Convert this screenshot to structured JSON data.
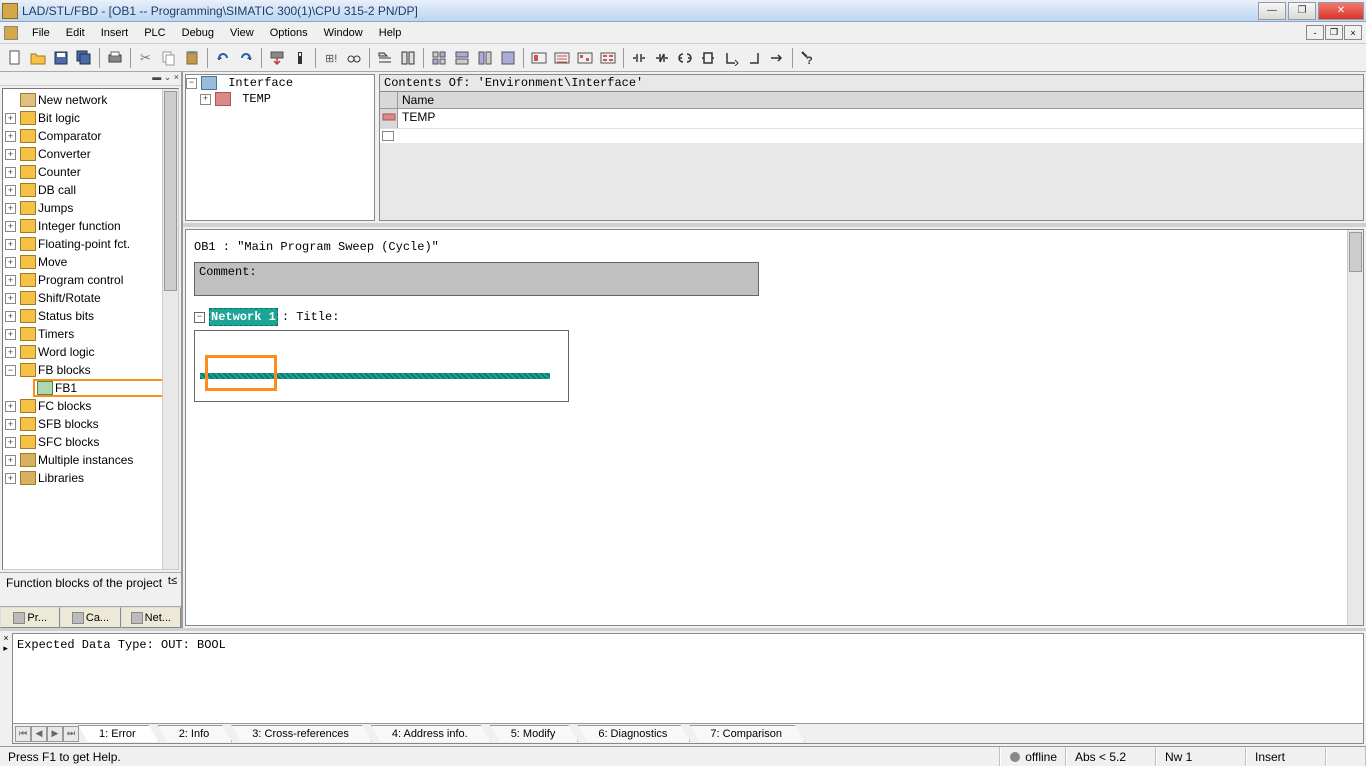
{
  "title": "LAD/STL/FBD  - [OB1 -- Programming\\SIMATIC 300(1)\\CPU 315-2 PN/DP]",
  "menu": [
    "File",
    "Edit",
    "Insert",
    "PLC",
    "Debug",
    "View",
    "Options",
    "Window",
    "Help"
  ],
  "sidebar": {
    "items": [
      {
        "label": "New network",
        "icon": "net"
      },
      {
        "label": "Bit logic",
        "icon": "folder"
      },
      {
        "label": "Comparator",
        "icon": "folder"
      },
      {
        "label": "Converter",
        "icon": "folder"
      },
      {
        "label": "Counter",
        "icon": "folder"
      },
      {
        "label": "DB call",
        "icon": "folder"
      },
      {
        "label": "Jumps",
        "icon": "folder"
      },
      {
        "label": "Integer function",
        "icon": "folder"
      },
      {
        "label": "Floating-point fct.",
        "icon": "folder"
      },
      {
        "label": "Move",
        "icon": "folder"
      },
      {
        "label": "Program control",
        "icon": "folder"
      },
      {
        "label": "Shift/Rotate",
        "icon": "folder"
      },
      {
        "label": "Status bits",
        "icon": "folder"
      },
      {
        "label": "Timers",
        "icon": "folder"
      },
      {
        "label": "Word logic",
        "icon": "folder"
      },
      {
        "label": "FB blocks",
        "icon": "folder",
        "open": true
      },
      {
        "label": "FB1",
        "icon": "fb",
        "child": true,
        "highlight": true
      },
      {
        "label": "FC blocks",
        "icon": "folder"
      },
      {
        "label": "SFB blocks",
        "icon": "folder"
      },
      {
        "label": "SFC blocks",
        "icon": "folder"
      },
      {
        "label": "Multiple instances",
        "icon": "book"
      },
      {
        "label": "Libraries",
        "icon": "book"
      }
    ],
    "desc": "Function blocks of the project",
    "tabs": [
      "Pr...",
      "Ca...",
      "Net..."
    ]
  },
  "interface": {
    "root": "Interface",
    "child": "TEMP",
    "contents_header": "Contents Of: 'Environment\\Interface'",
    "col_name": "Name",
    "row0": "TEMP"
  },
  "program": {
    "header": "OB1 :  \"Main Program Sweep (Cycle)\"",
    "comment_label": "Comment:",
    "network_label": "Network 1",
    "title_suffix": ": Title:"
  },
  "output": {
    "text": "Expected Data Type: OUT: BOOL",
    "tabs": [
      "1: Error",
      "2: Info",
      "3: Cross-references",
      "4: Address info.",
      "5: Modify",
      "6: Diagnostics",
      "7: Comparison"
    ]
  },
  "status": {
    "help": "Press F1 to get Help.",
    "offline": "offline",
    "abs": "Abs < 5.2",
    "nw": "Nw 1",
    "insert": "Insert"
  }
}
